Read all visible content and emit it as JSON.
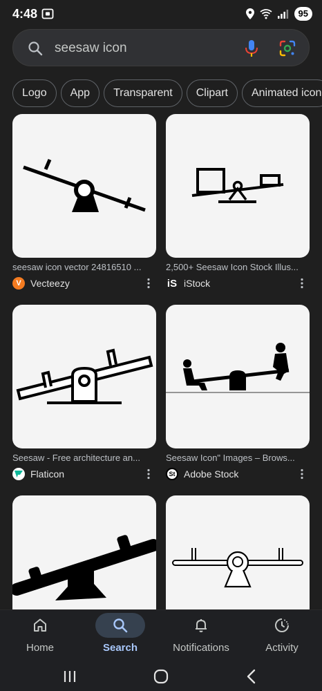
{
  "status_bar": {
    "time": "4:48",
    "battery": "95"
  },
  "search": {
    "query": "seesaw icon"
  },
  "chips": [
    "Logo",
    "App",
    "Transparent",
    "Clipart",
    "Animated icon"
  ],
  "results": [
    {
      "caption": "seesaw icon vector 24816510 ...",
      "source": "Vecteezy",
      "favicon_color": "#f47b20"
    },
    {
      "caption": "2,500+ Seesaw Icon Stock Illus...",
      "source": "iStock",
      "favicon_color": "#1f1f1f"
    },
    {
      "caption": "Seesaw - Free architecture an...",
      "source": "Flaticon",
      "favicon_color": "#ffffff"
    },
    {
      "caption": "Seesaw Icon\" Images – Brows...",
      "source": "Adobe Stock",
      "favicon_color": "#ffffff"
    }
  ],
  "bottom_nav": {
    "items": [
      {
        "label": "Home",
        "icon": "home-icon"
      },
      {
        "label": "Search",
        "icon": "search-icon",
        "active": true
      },
      {
        "label": "Notifications",
        "icon": "bell-icon"
      },
      {
        "label": "Activity",
        "icon": "history-icon"
      }
    ]
  },
  "colors": {
    "background": "#1f1f1f",
    "accent": "#a8c7fa",
    "active_pill": "#36414f"
  }
}
